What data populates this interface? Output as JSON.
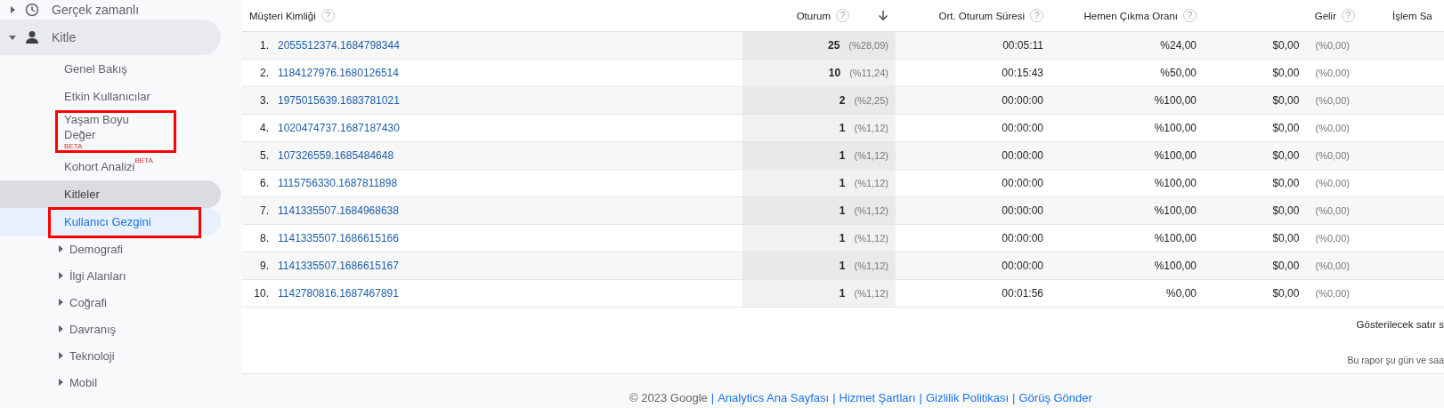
{
  "sidebar": {
    "sections": [
      {
        "label": "Gerçek zamanlı",
        "expanded": false
      },
      {
        "label": "Kitle",
        "expanded": true,
        "children": [
          {
            "label": "Genel Bakış",
            "kind": "link",
            "selected": false,
            "hovered": false,
            "annotated": false
          },
          {
            "label": "Etkin Kullanıcılar",
            "kind": "link",
            "selected": false,
            "hovered": false,
            "annotated": false
          },
          {
            "label": "Yaşam Boyu Değer",
            "kind": "link",
            "badge": "BETA",
            "selected": false,
            "hovered": false,
            "annotated": true
          },
          {
            "label": "Kohort Analizi",
            "kind": "link",
            "badge": "BETA",
            "selected": false,
            "hovered": false,
            "annotated": false
          },
          {
            "label": "Kitleler",
            "kind": "link",
            "selected": false,
            "hovered": true,
            "annotated": false
          },
          {
            "label": "Kullanıcı Gezgini",
            "kind": "link",
            "selected": true,
            "hovered": false,
            "annotated": true
          },
          {
            "label": "Demografi",
            "kind": "group",
            "selected": false,
            "hovered": false,
            "annotated": false
          },
          {
            "label": "İlgi Alanları",
            "kind": "group",
            "selected": false,
            "hovered": false,
            "annotated": false
          },
          {
            "label": "Coğrafi",
            "kind": "group",
            "selected": false,
            "hovered": false,
            "annotated": false
          },
          {
            "label": "Davranış",
            "kind": "group",
            "selected": false,
            "hovered": false,
            "annotated": false
          },
          {
            "label": "Teknoloji",
            "kind": "group",
            "selected": false,
            "hovered": false,
            "annotated": false
          },
          {
            "label": "Mobil",
            "kind": "group",
            "selected": false,
            "hovered": false,
            "annotated": false
          }
        ]
      }
    ]
  },
  "table": {
    "columns": [
      {
        "label": "Müşteri Kimliği",
        "help": "?",
        "sorted": false
      },
      {
        "label": "Oturum",
        "help": "?",
        "sorted": true
      },
      {
        "label": "Ort. Oturum Süresi",
        "help": "?",
        "sorted": false
      },
      {
        "label": "Hemen Çıkma Oranı",
        "help": "?",
        "sorted": false
      },
      {
        "label": "Gelir",
        "help": "?",
        "sorted": false
      },
      {
        "label": "İşlem Sa",
        "sorted": false
      }
    ],
    "rows": [
      {
        "rank": "1.",
        "client_id": "2055512374.1684798344",
        "sessions": "25",
        "sessions_pct": "(%28,09)",
        "avg_duration": "00:05:11",
        "bounce_rate": "%24,00",
        "revenue": "$0,00",
        "revenue_pct": "(%0,00)"
      },
      {
        "rank": "2.",
        "client_id": "1184127976.1680126514",
        "sessions": "10",
        "sessions_pct": "(%11,24)",
        "avg_duration": "00:15:43",
        "bounce_rate": "%50,00",
        "revenue": "$0,00",
        "revenue_pct": "(%0,00)"
      },
      {
        "rank": "3.",
        "client_id": "1975015639.1683781021",
        "sessions": "2",
        "sessions_pct": "(%2,25)",
        "avg_duration": "00:00:00",
        "bounce_rate": "%100,00",
        "revenue": "$0,00",
        "revenue_pct": "(%0,00)"
      },
      {
        "rank": "4.",
        "client_id": "1020474737.1687187430",
        "sessions": "1",
        "sessions_pct": "(%1,12)",
        "avg_duration": "00:00:00",
        "bounce_rate": "%100,00",
        "revenue": "$0,00",
        "revenue_pct": "(%0,00)"
      },
      {
        "rank": "5.",
        "client_id": "107326559.1685484648",
        "sessions": "1",
        "sessions_pct": "(%1,12)",
        "avg_duration": "00:00:00",
        "bounce_rate": "%100,00",
        "revenue": "$0,00",
        "revenue_pct": "(%0,00)"
      },
      {
        "rank": "6.",
        "client_id": "1115756330.1687811898",
        "sessions": "1",
        "sessions_pct": "(%1,12)",
        "avg_duration": "00:00:00",
        "bounce_rate": "%100,00",
        "revenue": "$0,00",
        "revenue_pct": "(%0,00)"
      },
      {
        "rank": "7.",
        "client_id": "1141335507.1684968638",
        "sessions": "1",
        "sessions_pct": "(%1,12)",
        "avg_duration": "00:00:00",
        "bounce_rate": "%100,00",
        "revenue": "$0,00",
        "revenue_pct": "(%0,00)"
      },
      {
        "rank": "8.",
        "client_id": "1141335507.1686615166",
        "sessions": "1",
        "sessions_pct": "(%1,12)",
        "avg_duration": "00:00:00",
        "bounce_rate": "%100,00",
        "revenue": "$0,00",
        "revenue_pct": "(%0,00)"
      },
      {
        "rank": "9.",
        "client_id": "1141335507.1686615167",
        "sessions": "1",
        "sessions_pct": "(%1,12)",
        "avg_duration": "00:00:00",
        "bounce_rate": "%100,00",
        "revenue": "$0,00",
        "revenue_pct": "(%0,00)"
      },
      {
        "rank": "10.",
        "client_id": "1142780816.1687467891",
        "sessions": "1",
        "sessions_pct": "(%1,12)",
        "avg_duration": "00:01:56",
        "bounce_rate": "%0,00",
        "revenue": "$0,00",
        "revenue_pct": "(%0,00)"
      }
    ],
    "rows_to_show_label": "Gösterilecek satır s",
    "report_note": "Bu rapor şu gün ve saa"
  },
  "footer": {
    "items": [
      {
        "kind": "text",
        "label": "© 2023 Google"
      },
      {
        "kind": "separator",
        "label": "|"
      },
      {
        "kind": "link",
        "label": "Analytics Ana Sayfası"
      },
      {
        "kind": "separator",
        "label": "|"
      },
      {
        "kind": "link",
        "label": "Hizmet Şartları"
      },
      {
        "kind": "separator",
        "label": "|"
      },
      {
        "kind": "link",
        "label": "Gizlilik Politikası"
      },
      {
        "kind": "separator",
        "label": "|"
      },
      {
        "kind": "link",
        "label": "Görüş Gönder"
      }
    ]
  }
}
